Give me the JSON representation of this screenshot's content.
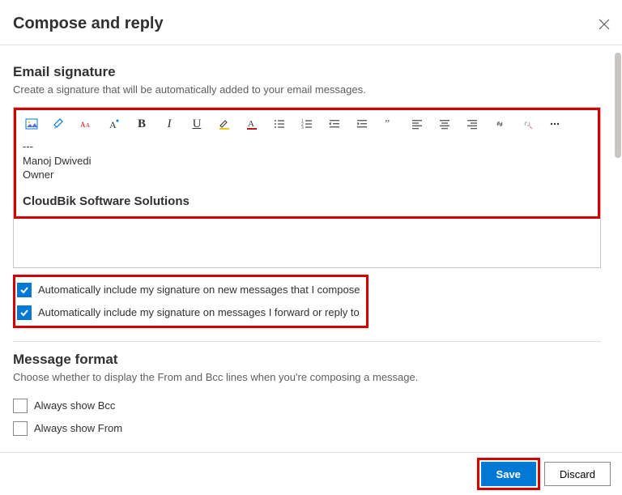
{
  "header": {
    "title": "Compose and reply"
  },
  "signature": {
    "section_title": "Email signature",
    "section_desc": "Create a signature that will be automatically added to your email messages.",
    "content": {
      "sep": "---",
      "name": "Manoj Dwivedi",
      "role": "Owner",
      "company": "CloudBik Software Solutions"
    },
    "options": {
      "auto_new": {
        "checked": true,
        "label": "Automatically include my signature on new messages that I compose"
      },
      "auto_reply": {
        "checked": true,
        "label": "Automatically include my signature on messages I forward or reply to"
      }
    }
  },
  "format": {
    "section_title": "Message format",
    "section_desc": "Choose whether to display the From and Bcc lines when you're composing a message.",
    "show_bcc": {
      "checked": false,
      "label": "Always show Bcc"
    },
    "show_from": {
      "checked": false,
      "label": "Always show From"
    }
  },
  "footer": {
    "save": "Save",
    "discard": "Discard"
  }
}
